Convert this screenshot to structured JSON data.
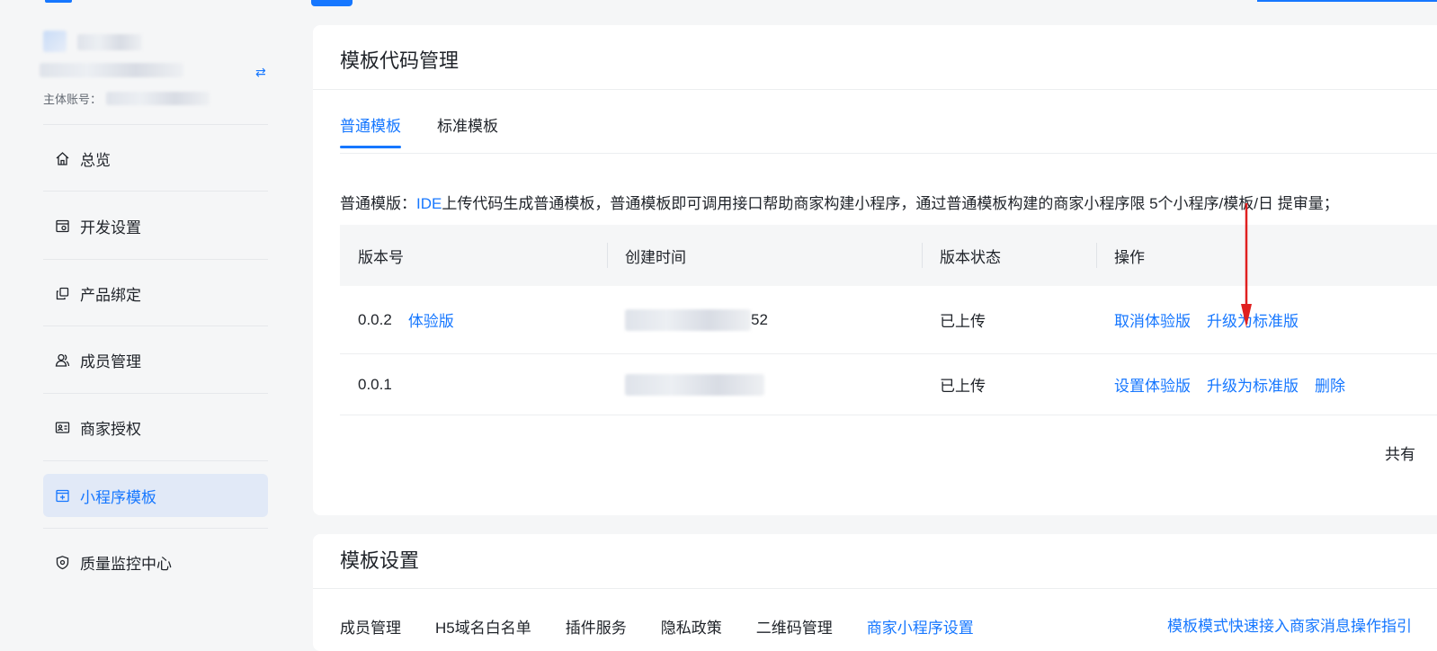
{
  "sidebar": {
    "account_label": "主体账号：",
    "switch_icon": "switch-arrows-icon",
    "items": [
      {
        "label": "总览",
        "icon": "home-icon",
        "active": false
      },
      {
        "label": "开发设置",
        "icon": "dev-settings-icon",
        "active": false
      },
      {
        "label": "产品绑定",
        "icon": "product-bind-icon",
        "active": false
      },
      {
        "label": "成员管理",
        "icon": "members-icon",
        "active": false
      },
      {
        "label": "商家授权",
        "icon": "merchant-auth-icon",
        "active": false
      },
      {
        "label": "小程序模板",
        "icon": "miniapp-template-icon",
        "active": true
      },
      {
        "label": "质量监控中心",
        "icon": "quality-shield-icon",
        "active": false
      }
    ]
  },
  "template_code": {
    "title": "模板代码管理",
    "tabs": [
      {
        "label": "普通模板",
        "active": true
      },
      {
        "label": "标准模板",
        "active": false
      }
    ],
    "description": {
      "prefix": "普通模版：",
      "ide": "IDE",
      "rest": "上传代码生成普通模板，普通模板即可调用接口帮助商家构建小程序，通过普通模板构建的商家小程序限 5个小程序/模板/日 提审量；"
    },
    "table": {
      "headers": [
        "版本号",
        "创建时间",
        "版本状态",
        "操作"
      ],
      "rows": [
        {
          "version": "0.0.2",
          "tag": "体验版",
          "time_tail": "52",
          "status": "已上传",
          "actions": [
            "取消体验版",
            "升级为标准版"
          ]
        },
        {
          "version": "0.0.1",
          "tag": "",
          "time_tail": "",
          "status": "已上传",
          "actions": [
            "设置体验版",
            "升级为标准版",
            "删除"
          ]
        }
      ]
    },
    "total_text": "共有"
  },
  "template_settings": {
    "title": "模板设置",
    "tabs": [
      {
        "label": "成员管理",
        "active": false
      },
      {
        "label": "H5域名白名单",
        "active": false
      },
      {
        "label": "插件服务",
        "active": false
      },
      {
        "label": "隐私政策",
        "active": false
      },
      {
        "label": "二维码管理",
        "active": false
      },
      {
        "label": "商家小程序设置",
        "active": true
      }
    ],
    "guide_link": "模板模式快速接入商家消息操作指引"
  },
  "colors": {
    "accent": "#1677ff",
    "annotation_arrow": "#e02020",
    "active_nav_bg": "#e1e9f7"
  }
}
